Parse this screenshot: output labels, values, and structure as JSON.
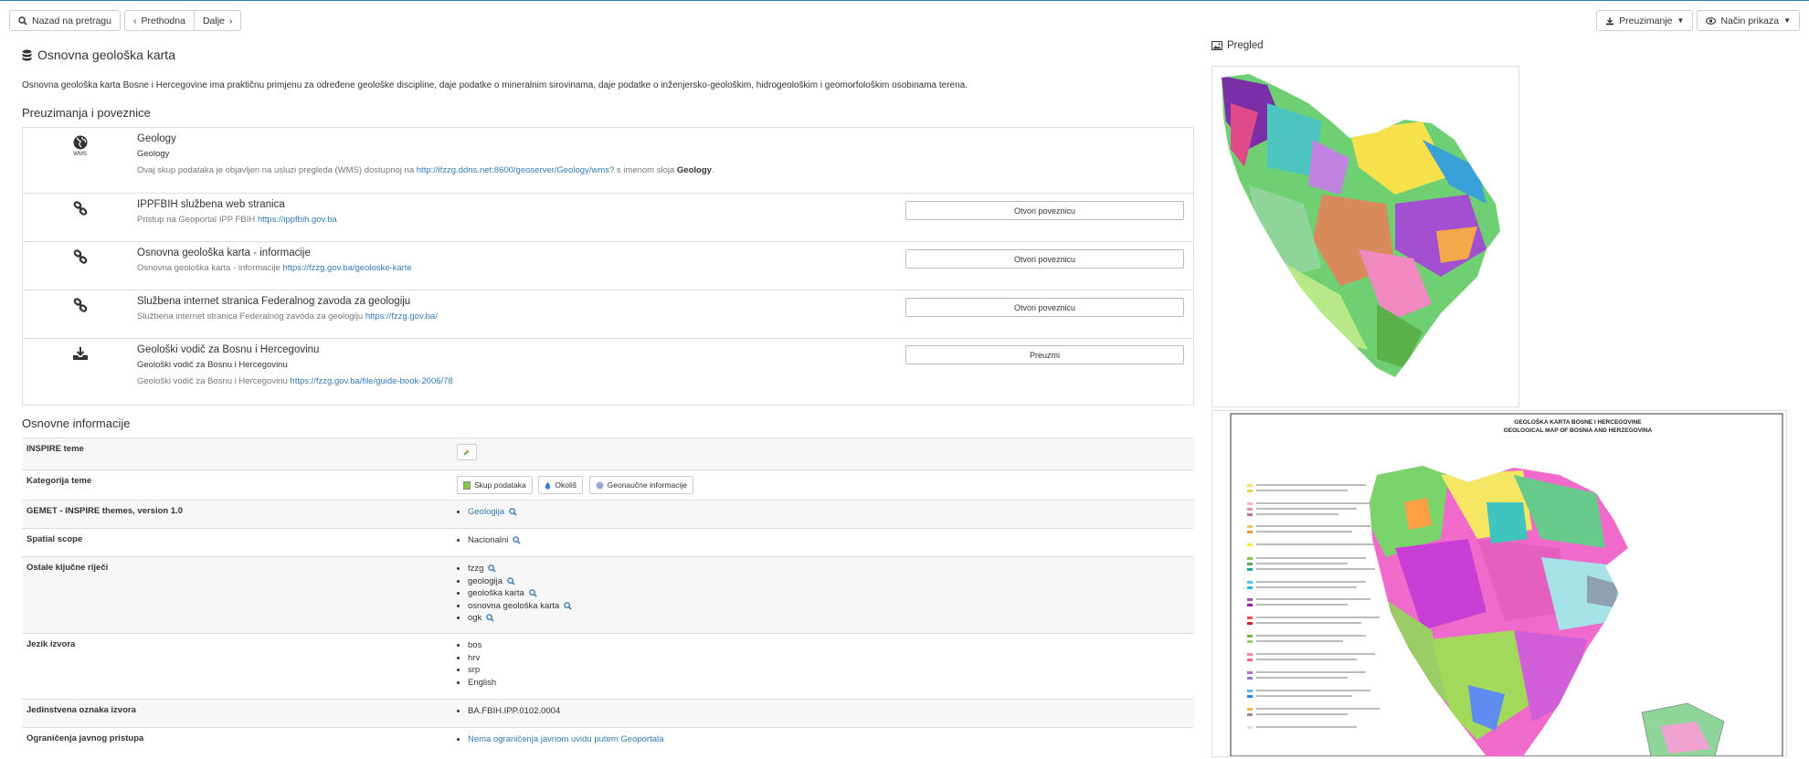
{
  "toolbar": {
    "back_label": "Nazad na pretragu",
    "prev_label": "Prethodna",
    "next_label": "Dalje",
    "download_label": "Preuzimanje",
    "view_label": "Način prikaza"
  },
  "page": {
    "title": "Osnovna geološka karta",
    "abstract": "Osnovna geološka karta Bosne i Hercegovine ima praktičnu primjenu za određene geološke discipline, daje podatke o mineralnim sirovinama, daje podatke o inženjersko-geološkim, hidrogeološkim i geomorfološkim osobinama terena."
  },
  "links_section": {
    "heading": "Preuzimanja i poveznice",
    "wms": {
      "icon_label": "WMS",
      "title": "Geology",
      "subtitle": "Geology",
      "desc_prefix": "Ovaj skup podataka je objavljen na usluzi pregleda (WMS) dostupnoj na",
      "url": "http://ifzzg.ddns.net:8600/geoserver/Geology/wms?",
      "desc_mid": "s imenom sloja",
      "layer": "Geology",
      "desc_end": "."
    },
    "items": [
      {
        "title": "IPPFBIH službena web stranica",
        "desc": "Pristup na Geoportal IPP FBIH",
        "url": "https://ippfbih.gov.ba",
        "action": "Otvori poveznicu"
      },
      {
        "title": "Osnovna geološka karta - informacije",
        "desc": "Osnovna geološka karta - informacije",
        "url": "https://fzzg.gov.ba/geoloske-karte",
        "action": "Otvori poveznicu"
      },
      {
        "title": "Službena internet stranica Federalnog zavoda za geologiju",
        "desc": "Službena internet stranica Federalnog zavoda za geologiju",
        "url": "https://fzzg.gov.ba/",
        "action": "Otvori poveznicu"
      }
    ],
    "download": {
      "title": "Geološki vodič za Bosnu i Hercegovinu",
      "subtitle": "Geološki vodič za Bosnu i Hercegovinu",
      "desc": "Geološki vodič za Bosnu i Hercegovinu",
      "url": "https://fzzg.gov.ba/file/guide-book-2006/78",
      "action": "Preuzmi"
    }
  },
  "info_section": {
    "heading": "Osnovne informacije",
    "inspire_label": "INSPIRE teme",
    "category_label": "Kategorija teme",
    "categories": [
      "Skup podataka",
      "Okoliš",
      "Geonaučne informacije"
    ],
    "gemet_label": "GEMET - INSPIRE themes, version 1.0",
    "gemet_value": "Geologija",
    "scope_label": "Spatial scope",
    "scope_value": "Nacionalni",
    "keywords_label": "Ostale ključne riječi",
    "keywords": [
      "fzzg",
      "geologija",
      "geološka karta",
      "osnovna geološka karta",
      "ogk"
    ],
    "lang_label": "Jezik izvora",
    "languages": [
      "bos",
      "hrv",
      "srp",
      "English"
    ],
    "id_label": "Jedinstvena oznaka izvora",
    "id_value": "BA.FBIH.IPP.0102.0004",
    "access_label": "Ograničenja javnog pristupa",
    "access_value": "Nema ograničenja javnom uvidu putem Geoportala"
  },
  "preview": {
    "heading": "Pregled",
    "map_title_1": "GEOLOŠKA KARTA  BOSNE  I  HERCEGOVINE",
    "map_title_2": "GEOLOGICAL MAP OF BOSNIA AND HERZEGOVINA"
  },
  "colors": {
    "link": "#337ab7",
    "border": "#dddddd"
  }
}
